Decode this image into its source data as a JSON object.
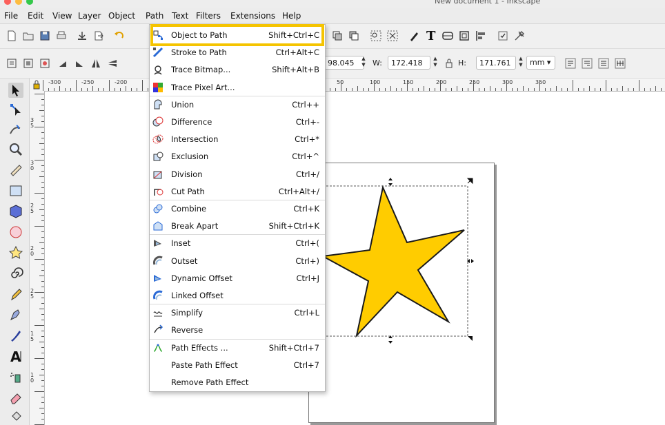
{
  "window": {
    "title": "New document 1 - Inkscape"
  },
  "menubar": {
    "items": [
      "File",
      "Edit",
      "View",
      "Layer",
      "Object",
      "Path",
      "Text",
      "Filters",
      "Extensions",
      "Help"
    ],
    "active": "Path"
  },
  "toolbar": {
    "x_value": "98.045",
    "w_label": "W:",
    "w_value": "172.418",
    "h_label": "H:",
    "h_value": "171.761",
    "unit": "mm"
  },
  "ruler": {
    "h_labels": [
      "-300",
      "-250",
      "-200",
      "50",
      "100",
      "150",
      "200",
      "250",
      "300",
      "350"
    ],
    "v_labels": [
      "3",
      "5",
      "3",
      "0",
      "2",
      "5",
      "2",
      "0",
      "2",
      "5",
      "1",
      "5",
      "1",
      "0"
    ]
  },
  "path_menu": {
    "groups": [
      [
        {
          "label": "Object to Path",
          "shortcut": "Shift+Ctrl+C",
          "icon": "object-to-path-icon"
        },
        {
          "label": "Stroke to Path",
          "shortcut": "Ctrl+Alt+C",
          "icon": "stroke-to-path-icon"
        },
        {
          "label": "Trace Bitmap...",
          "shortcut": "Shift+Alt+B",
          "icon": "trace-bitmap-icon"
        },
        {
          "label": "Trace Pixel Art...",
          "shortcut": "",
          "icon": "trace-pixel-art-icon"
        }
      ],
      [
        {
          "label": "Union",
          "shortcut": "Ctrl++",
          "icon": "union-icon"
        },
        {
          "label": "Difference",
          "shortcut": "Ctrl+-",
          "icon": "difference-icon"
        },
        {
          "label": "Intersection",
          "shortcut": "Ctrl+*",
          "icon": "intersection-icon"
        },
        {
          "label": "Exclusion",
          "shortcut": "Ctrl+^",
          "icon": "exclusion-icon"
        },
        {
          "label": "Division",
          "shortcut": "Ctrl+/",
          "icon": "division-icon"
        },
        {
          "label": "Cut Path",
          "shortcut": "Ctrl+Alt+/",
          "icon": "cut-path-icon"
        }
      ],
      [
        {
          "label": "Combine",
          "shortcut": "Ctrl+K",
          "icon": "combine-icon"
        },
        {
          "label": "Break Apart",
          "shortcut": "Shift+Ctrl+K",
          "icon": "break-apart-icon"
        }
      ],
      [
        {
          "label": "Inset",
          "shortcut": "Ctrl+(",
          "icon": "inset-icon"
        },
        {
          "label": "Outset",
          "shortcut": "Ctrl+)",
          "icon": "outset-icon"
        },
        {
          "label": "Dynamic Offset",
          "shortcut": "Ctrl+J",
          "icon": "dynamic-offset-icon"
        },
        {
          "label": "Linked Offset",
          "shortcut": "",
          "icon": "linked-offset-icon"
        }
      ],
      [
        {
          "label": "Simplify",
          "shortcut": "Ctrl+L",
          "icon": "simplify-icon"
        },
        {
          "label": "Reverse",
          "shortcut": "",
          "icon": "reverse-icon"
        }
      ],
      [
        {
          "label": "Path Effects ...",
          "shortcut": "Shift+Ctrl+7",
          "icon": "path-effects-icon"
        },
        {
          "label": "Paste Path Effect",
          "shortcut": "Ctrl+7",
          "icon": ""
        },
        {
          "label": "Remove Path Effect",
          "shortcut": "",
          "icon": ""
        }
      ]
    ]
  },
  "colors": {
    "star_fill": "#FFCC00",
    "highlight": "#F5C400",
    "accent": "#2a6ad6"
  }
}
